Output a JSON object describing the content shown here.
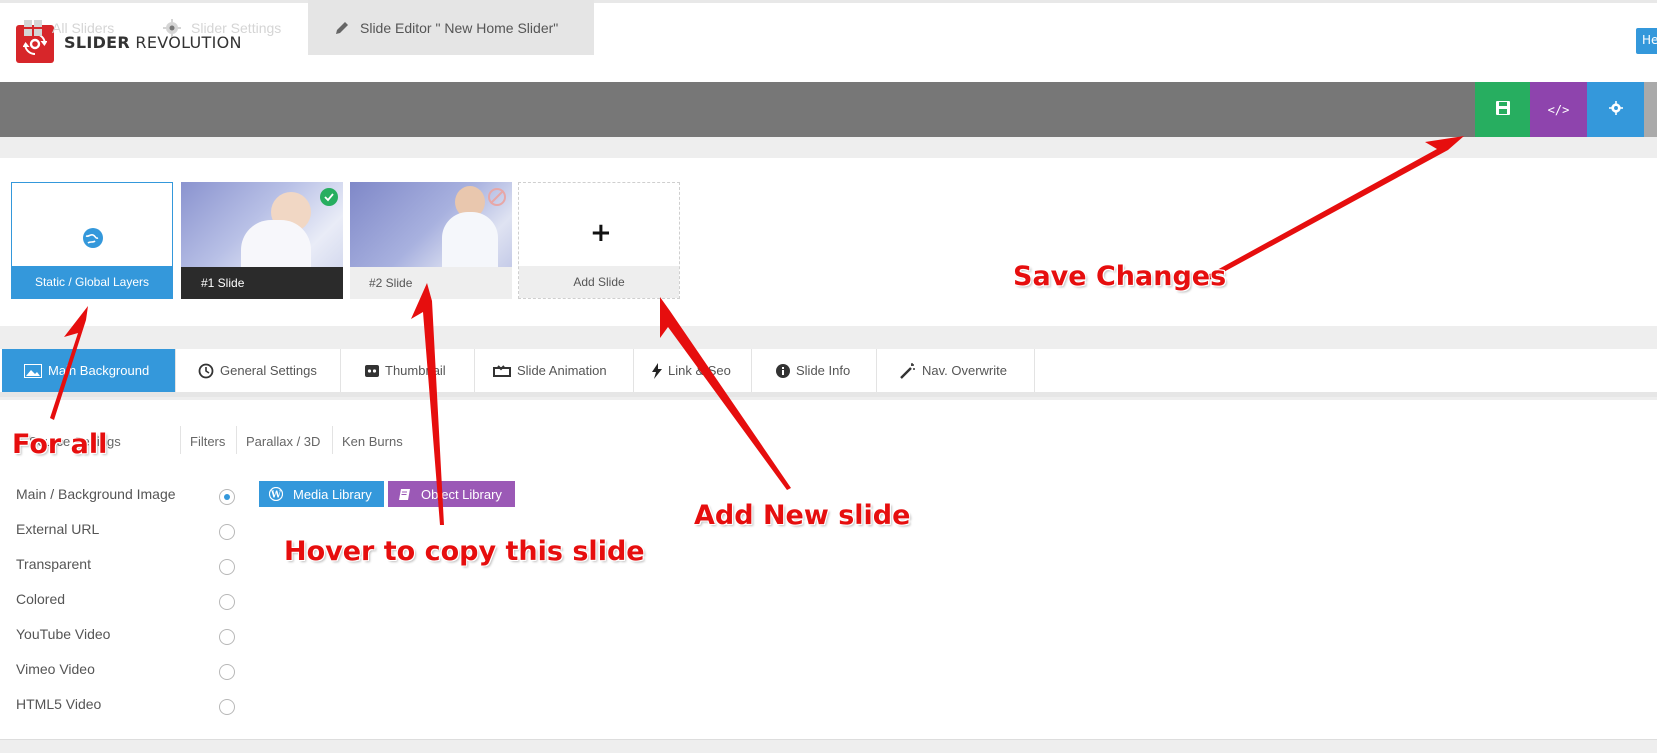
{
  "header": {
    "logo_bold": "SLIDER",
    "logo_light": "REVOLUTION",
    "help_label": "He"
  },
  "topnav": {
    "tabs": [
      {
        "label": "All Sliders",
        "icon": "grid-icon"
      },
      {
        "label": "Slider Settings",
        "icon": "gear-icon"
      },
      {
        "label": "Slide Editor \" New Home Slider\"",
        "icon": "pencil-icon"
      }
    ],
    "actions": [
      {
        "name": "save",
        "icon": "floppy-icon",
        "color": "#27ae60"
      },
      {
        "name": "embed",
        "icon": "code-icon",
        "label": "</>",
        "color": "#8e44ad"
      },
      {
        "name": "settings",
        "icon": "gear-icon",
        "color": "#3498db"
      }
    ]
  },
  "slides": [
    {
      "label": "Static / Global Layers"
    },
    {
      "label": "#1 Slide"
    },
    {
      "label": "#2 Slide"
    },
    {
      "label": "Add Slide"
    }
  ],
  "tabs": [
    {
      "label": "Main Background",
      "icon": "image-icon"
    },
    {
      "label": "General Settings",
      "icon": "history-icon"
    },
    {
      "label": "Thumbnail",
      "icon": "thumbnail-icon"
    },
    {
      "label": "Slide Animation",
      "icon": "animation-icon"
    },
    {
      "label": "Link & Seo",
      "icon": "bolt-icon"
    },
    {
      "label": "Slide Info",
      "icon": "info-icon"
    },
    {
      "label": "Nav. Overwrite",
      "icon": "wand-icon"
    }
  ],
  "subtabs": [
    "Source Settings",
    "Filters",
    "Parallax / 3D",
    "Ken Burns"
  ],
  "sources": [
    {
      "label": "Main / Background Image",
      "selected": true
    },
    {
      "label": "External URL",
      "selected": false
    },
    {
      "label": "Transparent",
      "selected": false
    },
    {
      "label": "Colored",
      "selected": false
    },
    {
      "label": "YouTube Video",
      "selected": false
    },
    {
      "label": "Vimeo Video",
      "selected": false
    },
    {
      "label": "HTML5 Video",
      "selected": false
    }
  ],
  "library_buttons": [
    {
      "label": "Media Library",
      "icon": "wordpress-icon",
      "color": "#3498db"
    },
    {
      "label": "Object Library",
      "icon": "book-icon",
      "color": "#9b59b6"
    }
  ],
  "annotations": {
    "save_changes": "Save Changes",
    "for_all": "For all",
    "hover_copy": "Hover to copy this slide",
    "add_new": "Add New slide"
  }
}
